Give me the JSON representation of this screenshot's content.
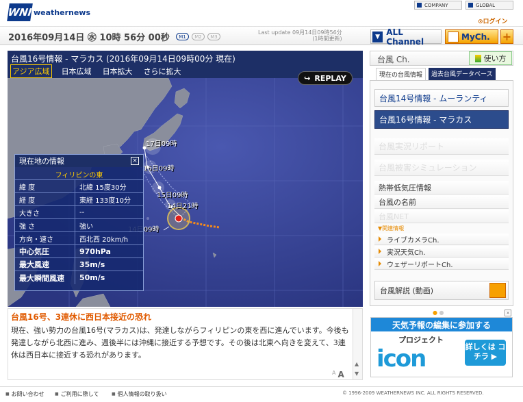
{
  "header": {
    "logo_text": "weathernews",
    "logo_mark": "WNI",
    "company_label": "COMPANY",
    "global_label": "GLOBAL",
    "login_label": "ログイン"
  },
  "topbar": {
    "datetime": "2016年09月14日 ㊌ 10時 56分 00秒",
    "pills": [
      "M1",
      "M2",
      "M3"
    ],
    "last_update_line1": "Last update  09月14日09時56分",
    "last_update_line2": "(1時間更新)",
    "all_channel": "ALL Channel",
    "mych": "MyCh.",
    "plus": "+"
  },
  "panel": {
    "title": "台風16号情報 - マラカス (2016年09月14日09時00分 現在)",
    "tabs": [
      "アジア広域",
      "日本広域",
      "日本拡大",
      "さらに拡大"
    ],
    "replay_label": "REPLAY",
    "track_labels": [
      "17日09時",
      "16日09時",
      "15日09時",
      "14日21時",
      "14日09時"
    ]
  },
  "info": {
    "header": "現在地の情報",
    "close": "×",
    "location": "フィリピンの東",
    "rows": [
      {
        "k": "緯 度",
        "v": "北緯 15度30分"
      },
      {
        "k": "経 度",
        "v": "東経 133度10分"
      },
      {
        "k": "大きさ",
        "v": "--"
      },
      {
        "k": "強 さ",
        "v": "強い"
      },
      {
        "k": "方向・速さ",
        "v": "西北西 20km/h"
      },
      {
        "k": "中心気圧",
        "v": "970hPa"
      },
      {
        "k": "最大風速",
        "v": "35m/s"
      },
      {
        "k": "最大瞬間風速",
        "v": "50m/s"
      }
    ]
  },
  "article": {
    "headline": "台風16号、3連休に西日本接近の恐れ",
    "body": "現在、強い勢力の台風16号(マラカス)は、発達しながらフィリピンの東を西に進んでいます。今後も発達しながら北西に進み、週後半には沖縄に接近する予想です。その後は北東へ向きを変えて、3連休は西日本に接近する恐れがあります。",
    "font_small": "A",
    "font_large": "A"
  },
  "sidebar": {
    "header": "台風 Ch.",
    "help": "使い方",
    "tab_current": "現在の台風情報",
    "tab_db": "過去台風データベース",
    "typhoon14": "台風14号情報 - ムーランティ",
    "typhoon16": "台風16号情報 - マラカス",
    "dim1": "台風実況リポート",
    "dim2": "台風被害シミュレーション",
    "links": [
      "熱帯低気圧情報",
      "台風の名前",
      "台風NET"
    ],
    "related_header": "関連情報",
    "related": [
      "ライブカメラCh.",
      "実況天気Ch.",
      "ウェザーリポートCh."
    ],
    "kaisetsu": "台風解説 (動画)"
  },
  "banner": {
    "title": "天気予報の編集に参加する",
    "project": "プロジェクト",
    "logo": "icon",
    "cta": "詳しくは コチラ ▶"
  },
  "footer": {
    "links": [
      "お問い合わせ",
      "ご利用に際して",
      "個人情報の取り扱い"
    ],
    "copyright": "© 1996-2009 WEATHERNEWS INC. ALL RIGHTS RESERVED."
  }
}
